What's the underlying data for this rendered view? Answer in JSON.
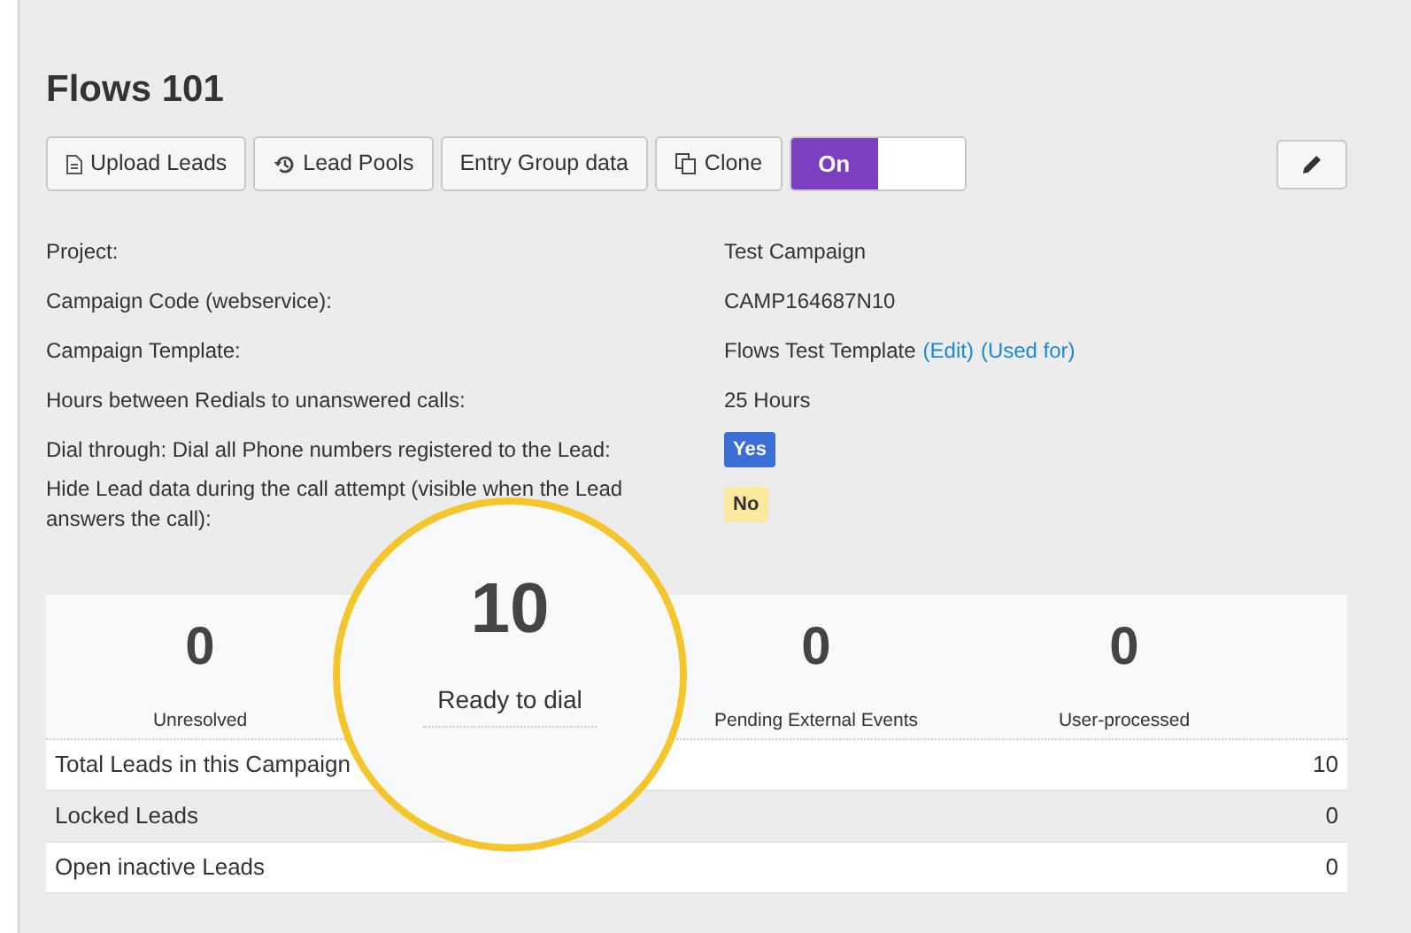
{
  "title": "Flows 101",
  "toolbar": [
    {
      "label": "Upload Leads"
    },
    {
      "label": "Lead Pools"
    },
    {
      "label": "Entry Group data"
    },
    {
      "label": "Clone"
    }
  ],
  "toggle": {
    "label": "On",
    "on": true
  },
  "details": [
    {
      "label": "Project:",
      "kind": "text",
      "value": "Test Campaign"
    },
    {
      "label": "Campaign Code (webservice):",
      "kind": "text",
      "value": "CAMP164687N10"
    },
    {
      "label": "Campaign Template:",
      "kind": "links",
      "value": "Flows Test Template",
      "links": [
        "(Edit)",
        "(Used for)"
      ]
    },
    {
      "label": "Hours between Redials to unanswered calls:",
      "kind": "text",
      "value": "25 Hours"
    },
    {
      "label": "Dial through: Dial all Phone numbers registered to the Lead:",
      "kind": "badge",
      "value": "Yes",
      "color": "#3b6fd6"
    },
    {
      "label": "Hide Lead data during the call attempt (visible when the Lead answers the call):",
      "kind": "badge",
      "value": "No",
      "color": "#fbe9a0"
    }
  ],
  "stats": [
    {
      "value": "0",
      "label": "Unresolved",
      "highlighted": false
    },
    {
      "value": "10",
      "label": "Ready to dial",
      "highlighted": true
    },
    {
      "value": "0",
      "label": "Pending External Events",
      "highlighted": false
    },
    {
      "value": "0",
      "label": "User-processed",
      "highlighted": false
    }
  ],
  "totals": [
    {
      "label": "Total Leads in this Campaign",
      "value": "10"
    },
    {
      "label": "Locked Leads",
      "value": "0"
    },
    {
      "label": "Open inactive Leads",
      "value": "0"
    }
  ]
}
